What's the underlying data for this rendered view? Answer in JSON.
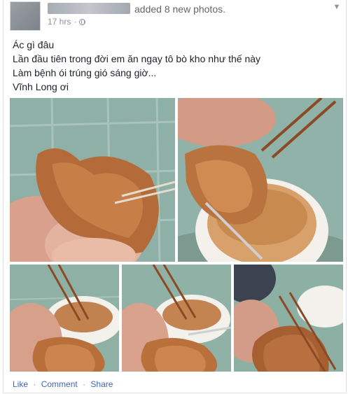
{
  "post": {
    "author_redacted": true,
    "action_text": "added 8 new photos.",
    "timestamp": "17 hrs",
    "dot": "·",
    "audience_icon": "globe-icon",
    "menu_icon": "chevron-down-icon",
    "lines": [
      "Ác gì đâu",
      "Lần đầu tiên trong đời em ăn ngay tô bò kho như thế này",
      "Làm bệnh ói trúng gió sáng giờ...",
      "Vĩnh Long ơi"
    ],
    "photos": [
      {
        "description": "photo-1"
      },
      {
        "description": "photo-2"
      },
      {
        "description": "photo-3"
      },
      {
        "description": "photo-4"
      },
      {
        "description": "photo-5"
      }
    ]
  },
  "footer": {
    "like": "Like",
    "comment": "Comment",
    "share": "Share",
    "separator": "·"
  },
  "colors": {
    "link": "#4267b2",
    "meta": "#90949c",
    "text": "#1d2129"
  }
}
